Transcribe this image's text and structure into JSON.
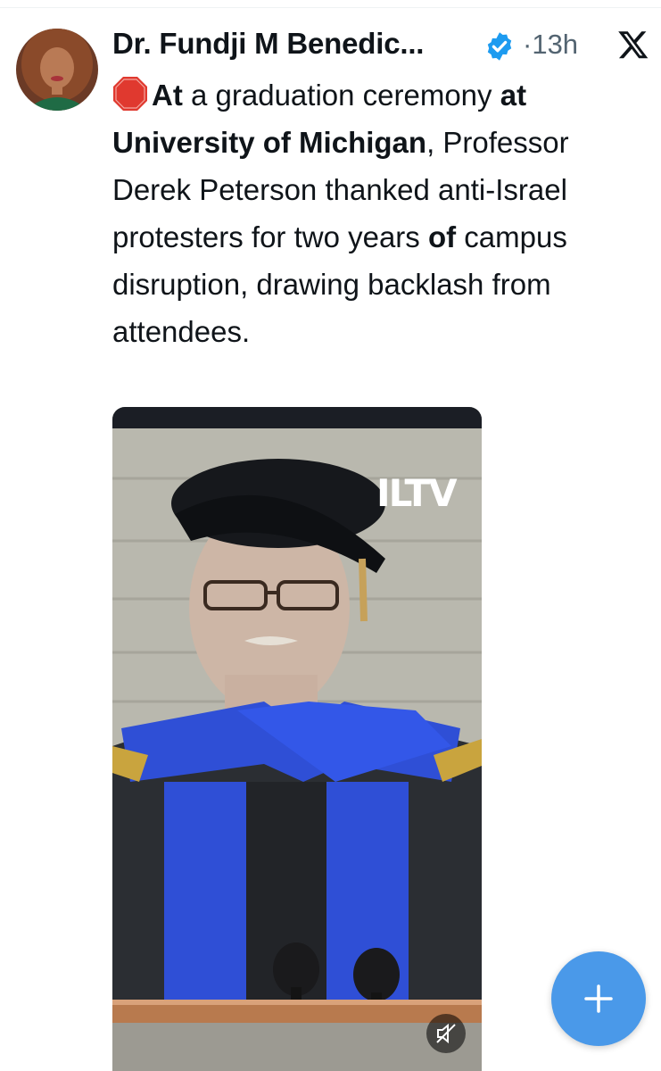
{
  "author": {
    "name": "Dr. Fundji M Benedic...",
    "verified": true,
    "time": "·13h"
  },
  "tweet": {
    "segments": [
      {
        "text": "At",
        "bold": true
      },
      {
        "text": " a graduation ceremony ",
        "bold": false
      },
      {
        "text": "at University of Michigan",
        "bold": true
      },
      {
        "text": ", Professor Derek Peterson thanked anti-Israel protesters for two years ",
        "bold": false
      },
      {
        "text": "of",
        "bold": true
      },
      {
        "text": " campus disruption, drawing backlash from attendees.",
        "bold": false
      }
    ]
  },
  "media": {
    "watermark": "ILTV",
    "muted": true
  },
  "icons": {
    "stop": "stop-sign-icon",
    "verified": "verified-badge-icon",
    "x": "x-logo-icon",
    "mute": "speaker-muted-icon",
    "compose": "plus-icon"
  },
  "colors": {
    "accent": "#1d9bf0",
    "fab": "#4a99e9",
    "muted_text": "#536471",
    "stop_red": "#e0392f"
  }
}
